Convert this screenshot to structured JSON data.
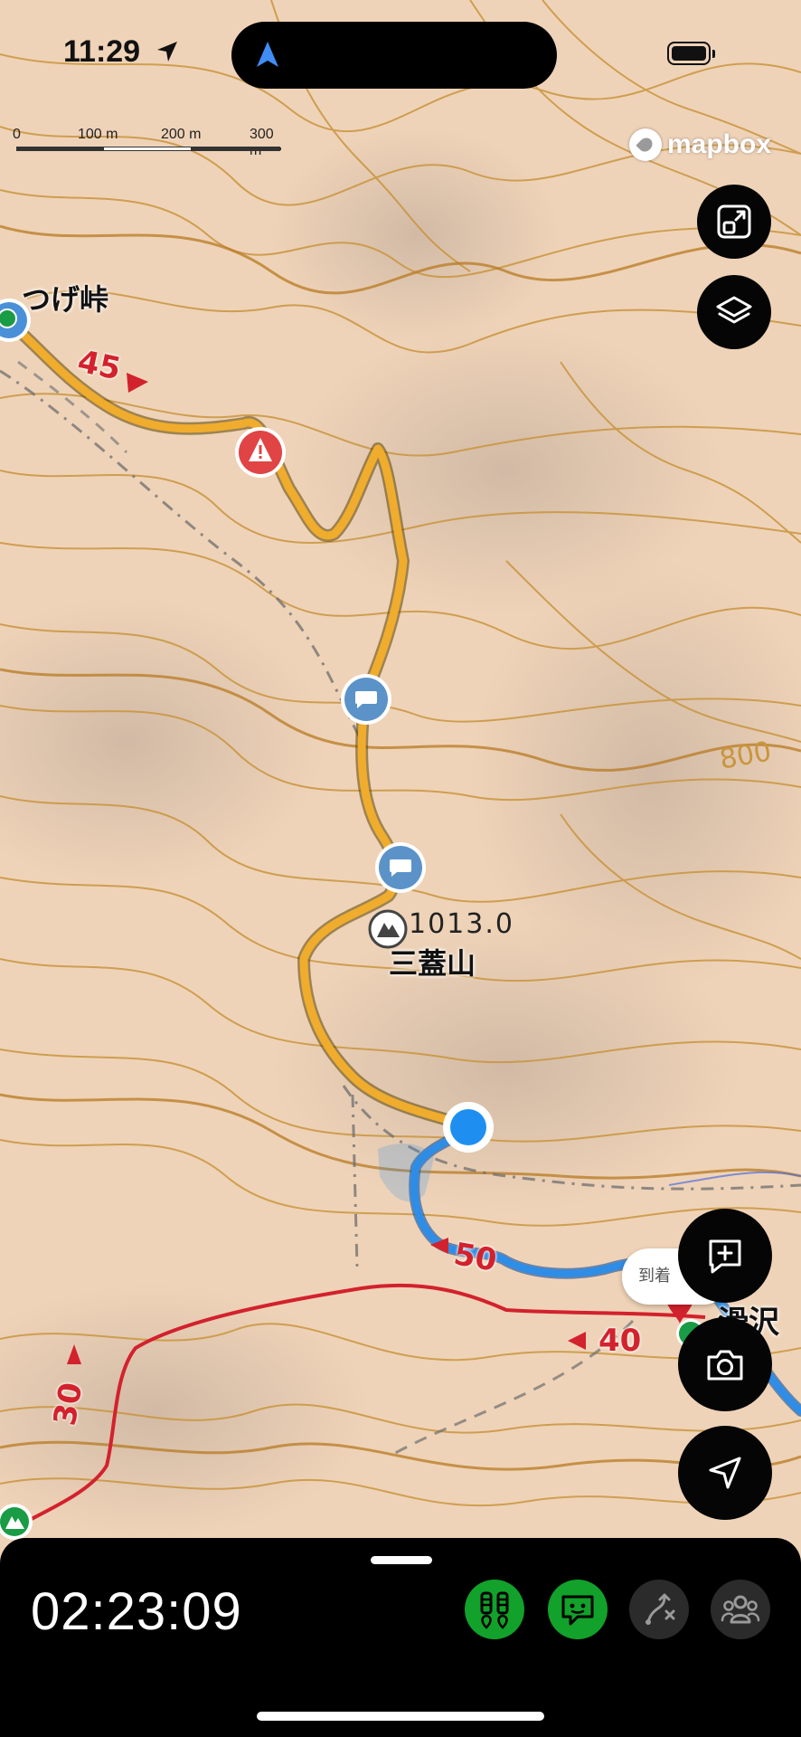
{
  "status_bar": {
    "time": "11:29"
  },
  "scale_bar": {
    "labels": [
      "0",
      "100 m",
      "200 m",
      "300 m"
    ]
  },
  "attribution": {
    "logo_text": "mapbox"
  },
  "map": {
    "place_labels": {
      "pass_north": "つげ峠",
      "summit_name": "三蓋山",
      "summit_elevation": "1013.0",
      "pass_southeast": "滑沢峠",
      "contour_800": "800"
    },
    "route_time_markers": {
      "m45": "45",
      "m50": "50",
      "m40": "40",
      "m30": "30"
    }
  },
  "tooltip": {
    "text": "到着"
  },
  "controls": {
    "expand": "expand-icon",
    "layers": "layers-icon",
    "add_note": "add-note-icon",
    "camera": "camera-icon",
    "locate": "location-arrow-icon"
  },
  "bottom_sheet": {
    "elapsed_time": "02:23:09",
    "mode_buttons": [
      {
        "icon": "hikers-pin-icon",
        "active": true
      },
      {
        "icon": "dog-chat-icon",
        "active": true
      },
      {
        "icon": "route-deviation-icon",
        "active": false
      },
      {
        "icon": "group-icon",
        "active": false
      }
    ]
  },
  "colors": {
    "planned_route": "#f0ac2c",
    "walked_route": "#2e8de6",
    "trail_red": "#d2222d",
    "contour": "#c9953e",
    "current_location": "#1e8ff0",
    "mode_active": "#12a12a"
  }
}
